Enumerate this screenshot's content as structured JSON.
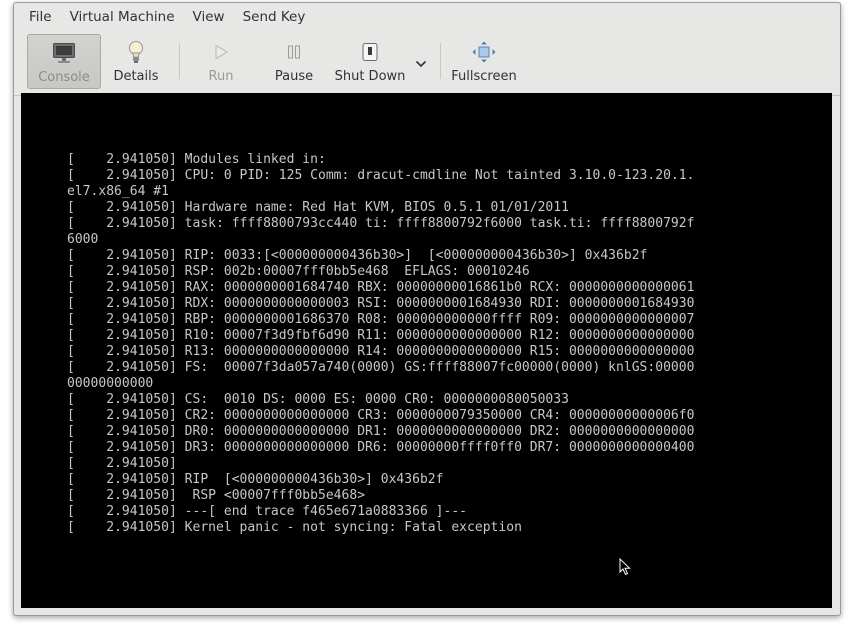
{
  "menubar": {
    "items": [
      "File",
      "Virtual Machine",
      "View",
      "Send Key"
    ]
  },
  "toolbar": {
    "console_label": "Console",
    "details_label": "Details",
    "run_label": "Run",
    "pause_label": "Pause",
    "shutdown_label": "Shut Down",
    "fullscreen_label": "Fullscreen",
    "icons": {
      "console": "monitor-icon",
      "details": "lightbulb-icon",
      "run": "play-icon",
      "pause": "pause-icon",
      "shutdown": "power-icon",
      "dropdown": "chevron-down-icon",
      "fullscreen": "fullscreen-icon"
    }
  },
  "console": {
    "lines": [
      "[    2.941050] Modules linked in:",
      "[    2.941050] CPU: 0 PID: 125 Comm: dracut-cmdline Not tainted 3.10.0-123.20.1.",
      "el7.x86_64 #1",
      "[    2.941050] Hardware name: Red Hat KVM, BIOS 0.5.1 01/01/2011",
      "[    2.941050] task: ffff8800793cc440 ti: ffff8800792f6000 task.ti: ffff8800792f",
      "6000",
      "[    2.941050] RIP: 0033:[<000000000436b30>]  [<000000000436b30>] 0x436b2f",
      "[    2.941050] RSP: 002b:00007fff0bb5e468  EFLAGS: 00010246",
      "[    2.941050] RAX: 0000000001684740 RBX: 00000000016861b0 RCX: 0000000000000061",
      "[    2.941050] RDX: 0000000000000003 RSI: 0000000001684930 RDI: 0000000001684930",
      "[    2.941050] RBP: 0000000001686370 R08: 000000000000ffff R09: 0000000000000007",
      "[    2.941050] R10: 00007f3d9fbf6d90 R11: 0000000000000000 R12: 0000000000000000",
      "[    2.941050] R13: 0000000000000000 R14: 0000000000000000 R15: 0000000000000000",
      "[    2.941050] FS:  00007f3da057a740(0000) GS:ffff88007fc00000(0000) knlGS:00000",
      "00000000000",
      "[    2.941050] CS:  0010 DS: 0000 ES: 0000 CR0: 0000000080050033",
      "[    2.941050] CR2: 0000000000000000 CR3: 0000000079350000 CR4: 00000000000006f0",
      "[    2.941050] DR0: 0000000000000000 DR1: 0000000000000000 DR2: 0000000000000000",
      "[    2.941050] DR3: 0000000000000000 DR6: 00000000ffff0ff0 DR7: 0000000000000400",
      "[    2.941050]",
      "[    2.941050] RIP  [<000000000436b30>] 0x436b2f",
      "[    2.941050]  RSP <00007fff0bb5e468>",
      "[    2.941050] ---[ end trace f465e671a0883366 ]---",
      "[    2.941050] Kernel panic - not syncing: Fatal exception"
    ]
  },
  "colors": {
    "window_bg": "#e7e7e6",
    "console_bg": "#000000",
    "console_text": "#c7c7c7"
  }
}
